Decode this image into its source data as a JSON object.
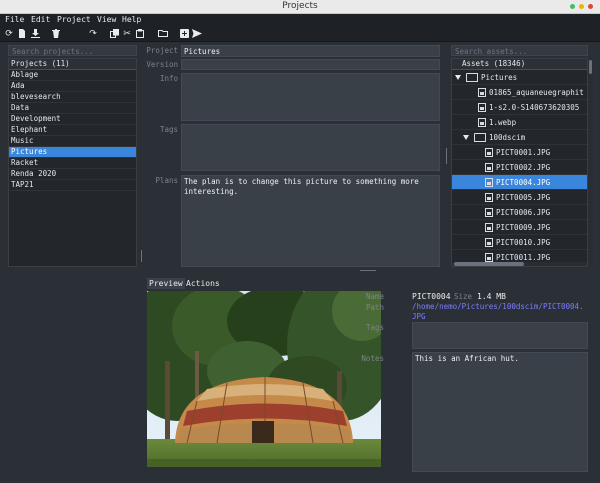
{
  "window": {
    "title": "Projects"
  },
  "menu": [
    "File",
    "Edit",
    "Project",
    "View",
    "Help"
  ],
  "toolbar_icons": [
    "refresh-icon",
    "new-file-icon",
    "download-icon",
    "trash-icon",
    "redo-icon",
    "copy-icon",
    "cut-icon",
    "paste-icon",
    "folder-icon",
    "add-icon",
    "send-icon"
  ],
  "projects": {
    "search_placeholder": "Search projects...",
    "header": "Projects (11)",
    "items": [
      "Ablage",
      "Ada",
      "blevesearch",
      "Data",
      "Development",
      "Elephant",
      "Music",
      "Pictures",
      "Racket",
      "Renda 2020",
      "TAP21"
    ],
    "selected": "Pictures"
  },
  "form": {
    "project_label": "Project",
    "project_value": "Pictures",
    "version_label": "Version",
    "version_value": "",
    "info_label": "Info",
    "info_value": "",
    "tags_label": "Tags",
    "tags_value": "",
    "plans_label": "Plans",
    "plans_value": "The plan is to change this picture to something more interesting."
  },
  "assets": {
    "search_placeholder": "Search assets...",
    "header": "Assets (18346)",
    "tree": [
      {
        "type": "folder",
        "label": "Pictures",
        "level": 0,
        "expanded": true
      },
      {
        "type": "file",
        "label": "01865_aquaneuegraphit",
        "level": 1
      },
      {
        "type": "file",
        "label": "1-s2.0-S140673620305",
        "level": 1
      },
      {
        "type": "file",
        "label": "1.webp",
        "level": 1
      },
      {
        "type": "folder",
        "label": "100dscim",
        "level": 1,
        "expanded": true
      },
      {
        "type": "file",
        "label": "PICT0001.JPG",
        "level": 2
      },
      {
        "type": "file",
        "label": "PICT0002.JPG",
        "level": 2
      },
      {
        "type": "file",
        "label": "PICT0004.JPG",
        "level": 2,
        "selected": true
      },
      {
        "type": "file",
        "label": "PICT0005.JPG",
        "level": 2
      },
      {
        "type": "file",
        "label": "PICT0006.JPG",
        "level": 2
      },
      {
        "type": "file",
        "label": "PICT0009.JPG",
        "level": 2
      },
      {
        "type": "file",
        "label": "PICT0010.JPG",
        "level": 2
      },
      {
        "type": "file",
        "label": "PICT0011.JPG",
        "level": 2
      }
    ]
  },
  "bottom": {
    "tabs": [
      "Preview",
      "Actions"
    ],
    "active_tab": "Preview",
    "name_label": "Name",
    "name_value": "PICT0004",
    "size_label": "Size",
    "size_value": "1.4 MB",
    "path_label": "Path",
    "path_value": "/home/nemo/Pictures/100dscim/PICT0004.JPG",
    "tags_label": "Tags",
    "tags_value": "",
    "notes_label": "Notes",
    "notes_value": "This is an African hut."
  },
  "colors": {
    "background": "#2b2f36",
    "selection": "#3a86dc",
    "path_link": "#7d7dff"
  }
}
